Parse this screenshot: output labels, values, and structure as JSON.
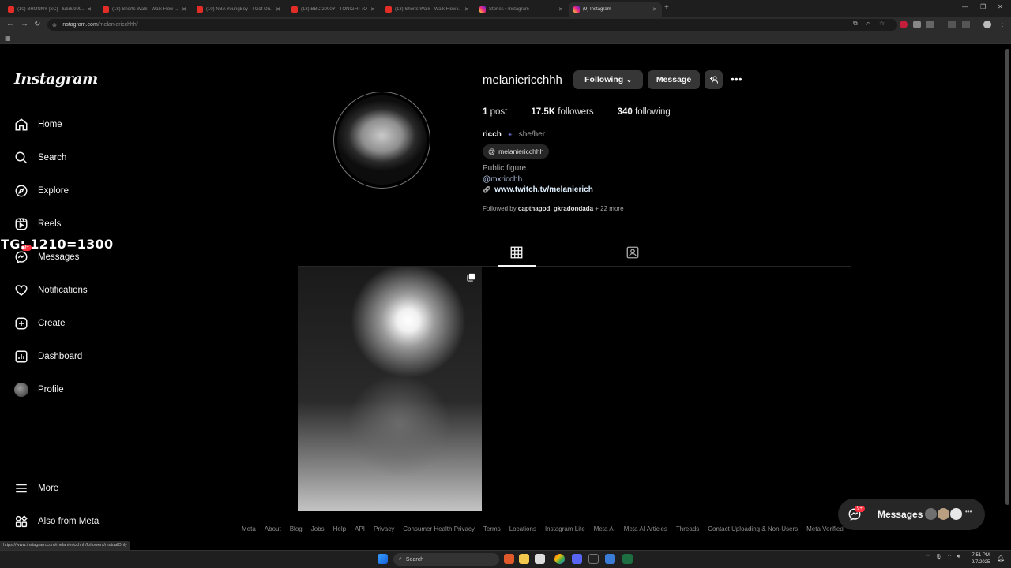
{
  "browser": {
    "tabs": [
      {
        "title": "(10) BRONNY [SC] - lubdu999...",
        "icon": "youtube-icon"
      },
      {
        "title": "(18) Shorts Walk - Walk Flow i...",
        "icon": "youtube-icon"
      },
      {
        "title": "(10) NBA YoungBoy - I Got Ou...",
        "icon": "youtube-icon"
      },
      {
        "title": "(13) BBC 2000Y - TONIGHT (O...",
        "icon": "youtube-icon"
      },
      {
        "title": "(13) Shorts Walk - Walk Flow i...",
        "icon": "youtube-icon"
      },
      {
        "title": "Stories • Instagram",
        "icon": "instagram-icon"
      },
      {
        "title": "(9) Instagram",
        "icon": "instagram-icon"
      }
    ],
    "url_host": "instagram.com",
    "url_path": "/melaniericchhh/",
    "status_url": "https://www.instagram.com/melaniericchhh/followers/mutualOnly"
  },
  "sidebar": {
    "logo": "Instagram",
    "items": [
      {
        "label": "Home",
        "icon": "home-icon"
      },
      {
        "label": "Search",
        "icon": "search-icon"
      },
      {
        "label": "Explore",
        "icon": "compass-icon"
      },
      {
        "label": "Reels",
        "icon": "reels-icon"
      },
      {
        "label": "Messages",
        "icon": "messenger-icon",
        "badge": "9+"
      },
      {
        "label": "Notifications",
        "icon": "heart-icon"
      },
      {
        "label": "Create",
        "icon": "plus-square-icon"
      },
      {
        "label": "Dashboard",
        "icon": "dashboard-icon"
      },
      {
        "label": "Profile",
        "icon": "avatar"
      }
    ],
    "more": "More",
    "also_from_meta": "Also from Meta"
  },
  "overlay_text": "TG: 1210=1300",
  "profile": {
    "username": "melaniericchhh",
    "following_button": "Following",
    "message_button": "Message",
    "posts_count": "1",
    "posts_label": "post",
    "followers_count": "17.5K",
    "followers_label": "followers",
    "following_count": "340",
    "following_label": "following",
    "display_name": "ricch",
    "pronouns": "she/her",
    "threads_handle": "melaniericchhh",
    "category": "Public figure",
    "mention": "@mxricchh",
    "external_link": "www.twitch.tv/melanierich",
    "followed_by_prefix": "Followed by",
    "followed_by_names": "capthagod, gkradondada",
    "followed_by_more": "+ 22 more"
  },
  "footer_links": [
    "Meta",
    "About",
    "Blog",
    "Jobs",
    "Help",
    "API",
    "Privacy",
    "Consumer Health Privacy",
    "Terms",
    "Locations",
    "Instagram Lite",
    "Meta AI",
    "Meta AI Articles",
    "Threads",
    "Contact Uploading & Non-Users",
    "Meta Verified"
  ],
  "messages_pill": {
    "label": "Messages",
    "badge": "9+"
  },
  "taskbar": {
    "search_placeholder": "Search",
    "time": "7:51 PM",
    "date": "9/7/2025"
  }
}
